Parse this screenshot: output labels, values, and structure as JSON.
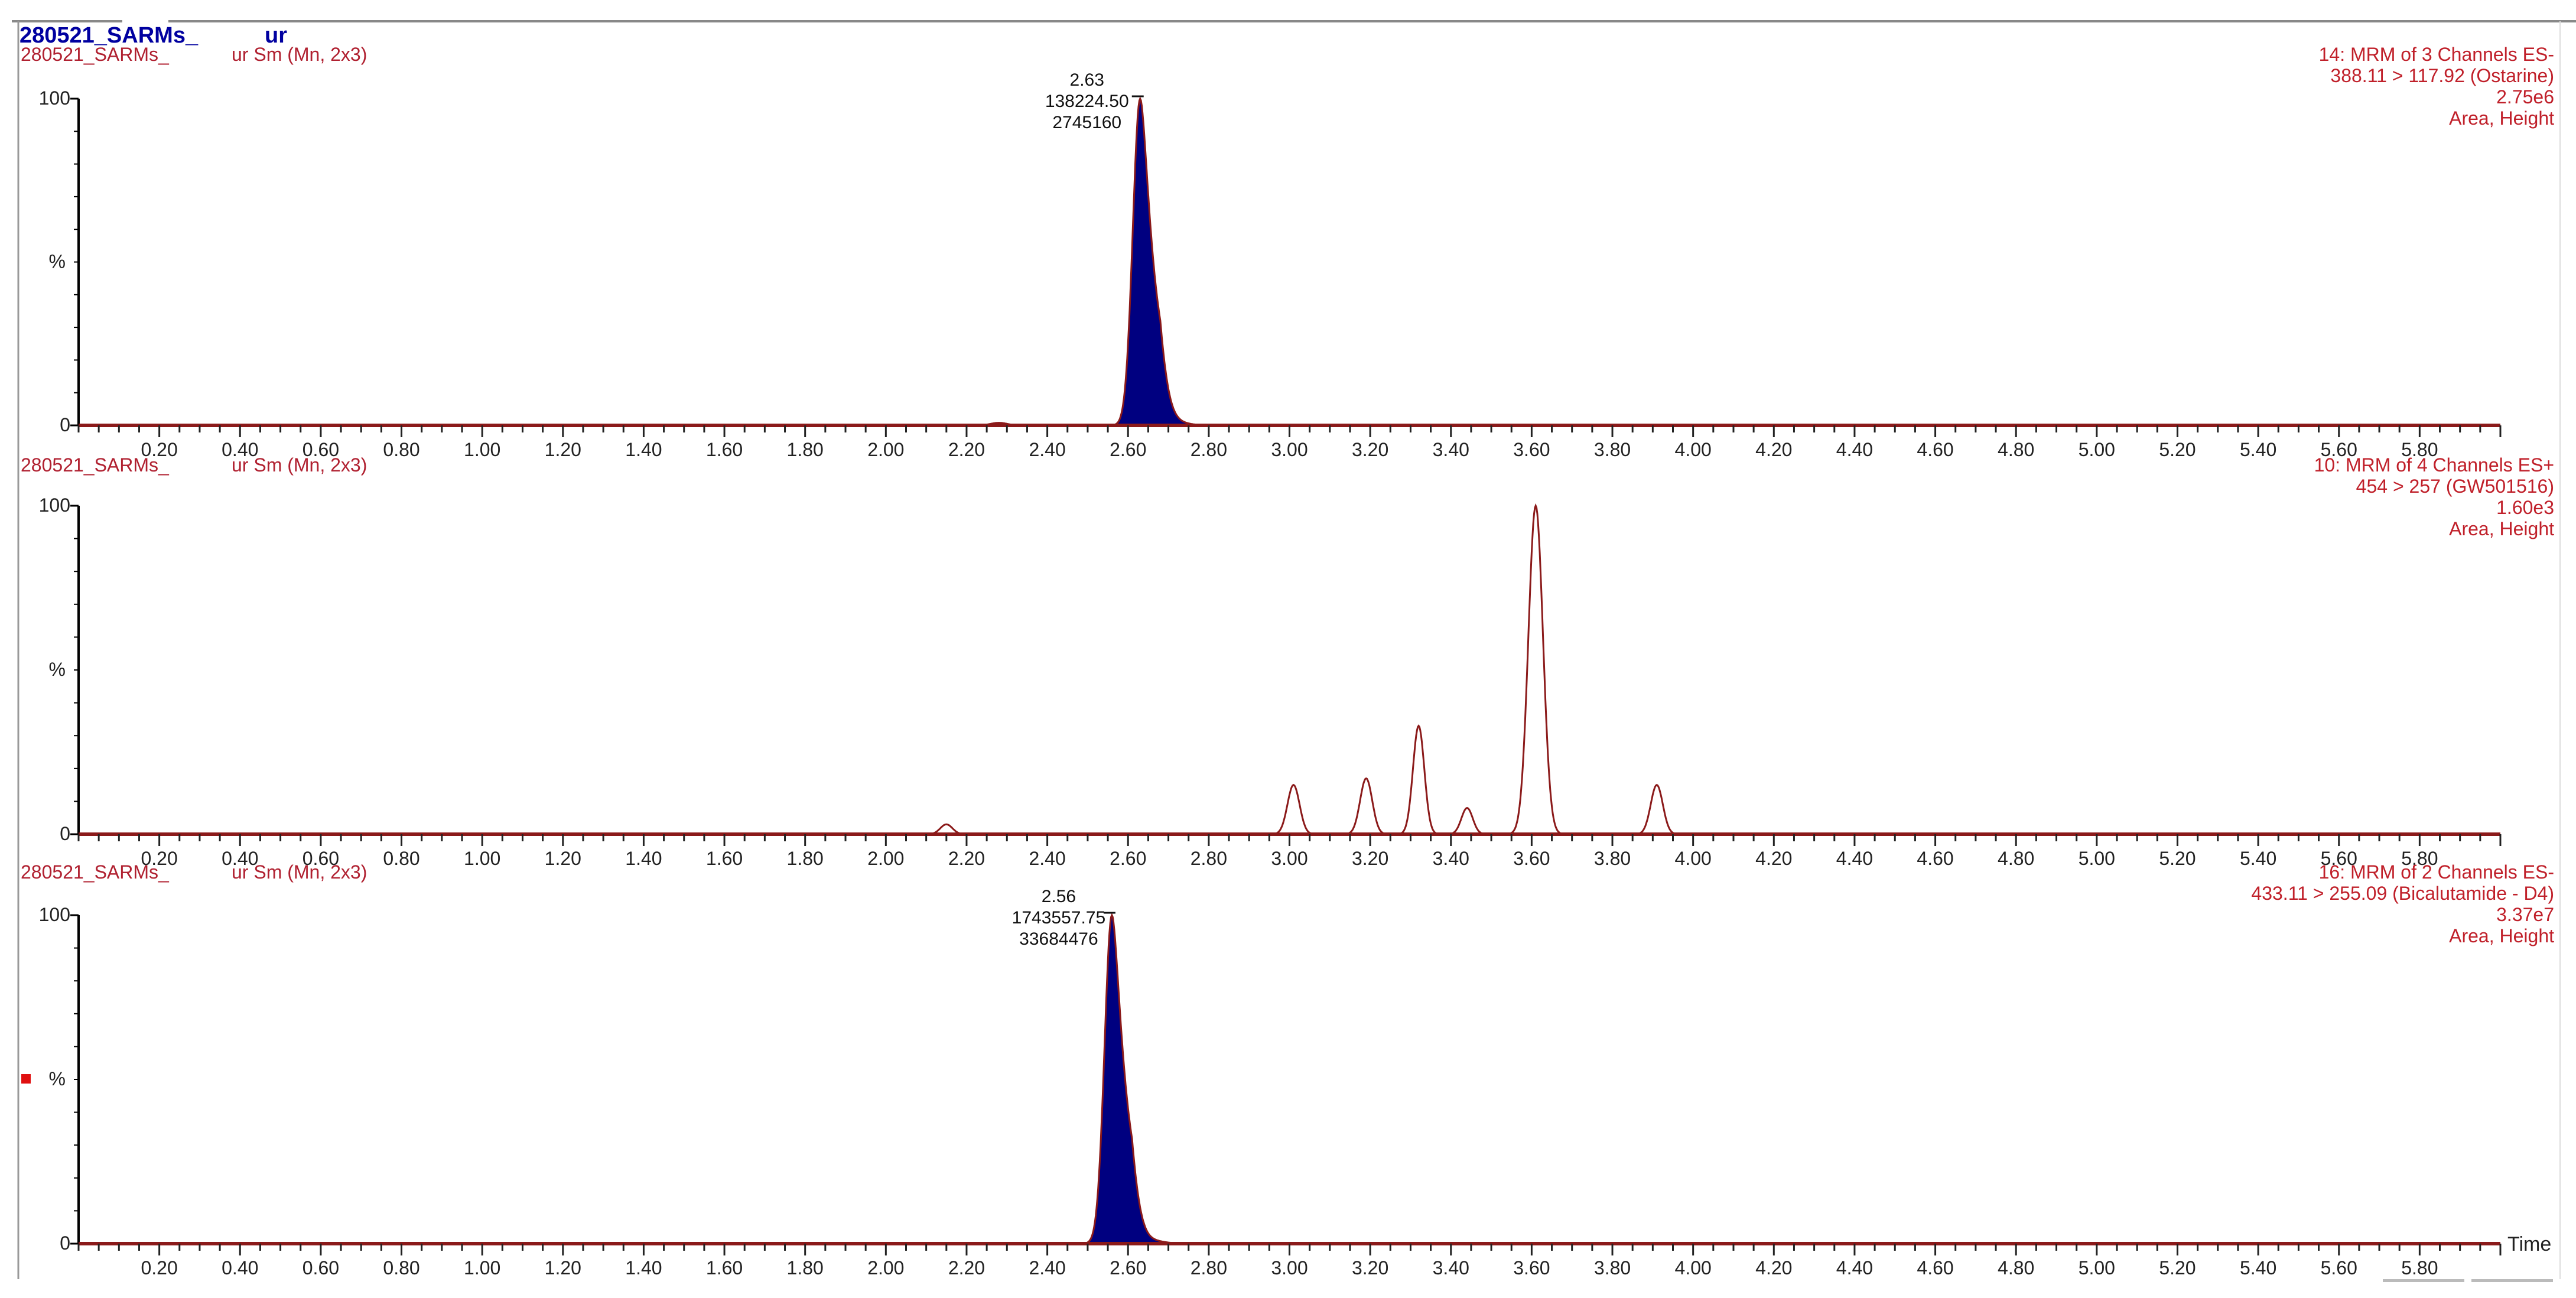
{
  "header": {
    "title_left": "280521_SARMs_",
    "title_right": "ur"
  },
  "colors": {
    "trace": "#8b1a1a",
    "fill": "#000080",
    "label": "#c0202a",
    "header": "#0000a0",
    "marker": "#e01010"
  },
  "chart_data": [
    {
      "type": "line",
      "sample_left": "280521_SARMs_",
      "sample_right": "ur Sm (Mn, 2x3)",
      "info": [
        "14: MRM of 3 Channels ES-",
        "388.11 > 117.92 (Ostarine)",
        "2.75e6",
        "Area, Height"
      ],
      "ylabel": "%",
      "y_ticks": [
        "100",
        "0"
      ],
      "ylim": [
        0,
        100
      ],
      "xlim": [
        0,
        6
      ],
      "filled": true,
      "peaks": [
        {
          "rt": 2.63,
          "height": 100,
          "sigma": 0.018,
          "tail": 0.025
        },
        {
          "rt": 2.28,
          "height": 0.8,
          "sigma": 0.02,
          "tail": 0
        },
        {
          "rt": 2.72,
          "height": 0.8,
          "sigma": 0.03,
          "tail": 0
        }
      ],
      "annotation": {
        "rt": "2.63",
        "area": "138224.50",
        "height": "2745160",
        "x": 2.63
      }
    },
    {
      "type": "line",
      "sample_left": "280521_SARMs_",
      "sample_right": "ur Sm (Mn, 2x3)",
      "info": [
        "10: MRM of 4 Channels ES+",
        "454 > 257 (GW501516)",
        "1.60e3",
        "Area, Height"
      ],
      "ylabel": "%",
      "y_ticks": [
        "100",
        "0"
      ],
      "ylim": [
        0,
        100
      ],
      "xlim": [
        0,
        6
      ],
      "filled": false,
      "peaks": [
        {
          "rt": 2.15,
          "height": 3,
          "sigma": 0.015,
          "tail": 0
        },
        {
          "rt": 3.01,
          "height": 15,
          "sigma": 0.015,
          "tail": 0
        },
        {
          "rt": 3.19,
          "height": 17,
          "sigma": 0.015,
          "tail": 0
        },
        {
          "rt": 3.32,
          "height": 33,
          "sigma": 0.014,
          "tail": 0
        },
        {
          "rt": 3.44,
          "height": 8,
          "sigma": 0.014,
          "tail": 0
        },
        {
          "rt": 3.61,
          "height": 100,
          "sigma": 0.018,
          "tail": 0
        },
        {
          "rt": 3.91,
          "height": 15,
          "sigma": 0.015,
          "tail": 0
        }
      ],
      "annotation": null
    },
    {
      "type": "line",
      "sample_left": "280521_SARMs_",
      "sample_right": "ur Sm (Mn, 2x3)",
      "info": [
        "16: MRM of 2 Channels ES-",
        "433.11 > 255.09 (Bicalutamide - D4)",
        "3.37e7",
        "Area, Height"
      ],
      "ylabel": "%",
      "y_ticks": [
        "100",
        "0"
      ],
      "ylim": [
        0,
        100
      ],
      "xlim": [
        0,
        6
      ],
      "xlabel": "Time",
      "filled": true,
      "peaks": [
        {
          "rt": 2.56,
          "height": 100,
          "sigma": 0.018,
          "tail": 0.025
        },
        {
          "rt": 2.66,
          "height": 0.8,
          "sigma": 0.03,
          "tail": 0
        }
      ],
      "annotation": {
        "rt": "2.56",
        "area": "1743557.75",
        "height": "33684476",
        "x": 2.56
      }
    }
  ],
  "x_tick_labels": [
    "0.20",
    "0.40",
    "0.60",
    "0.80",
    "1.00",
    "1.20",
    "1.40",
    "1.60",
    "1.80",
    "2.00",
    "2.20",
    "2.40",
    "2.60",
    "2.80",
    "3.00",
    "3.20",
    "3.40",
    "3.60",
    "3.80",
    "4.00",
    "4.20",
    "4.40",
    "4.60",
    "4.80",
    "5.00",
    "5.20",
    "5.40",
    "5.60",
    "5.80"
  ]
}
